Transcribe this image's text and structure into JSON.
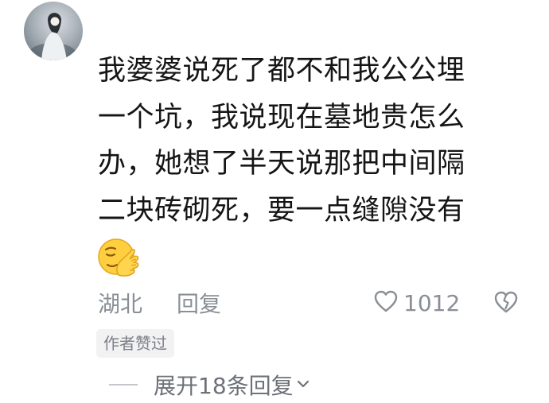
{
  "comment": {
    "lines": [
      "我婆婆说死了都不和我公公埋",
      "一个坑，我说现在墓地贵怎么",
      "办，她想了半天说那把中间隔",
      "二块砖砌死，要一点缝隙没有"
    ],
    "emoji": "facepalm-emoji",
    "location": "湖北",
    "reply_label": "回复",
    "like_count": "1012",
    "author_badge": "作者赞过"
  },
  "replies": {
    "expand_label": "展开18条回复"
  },
  "icons": {
    "like": "heart-outline-icon",
    "dislike": "broken-heart-icon",
    "expand": "chevron-down-icon"
  },
  "colors": {
    "text": "#151515",
    "meta": "#8a8f96",
    "badge_bg": "#f2f2f3"
  }
}
